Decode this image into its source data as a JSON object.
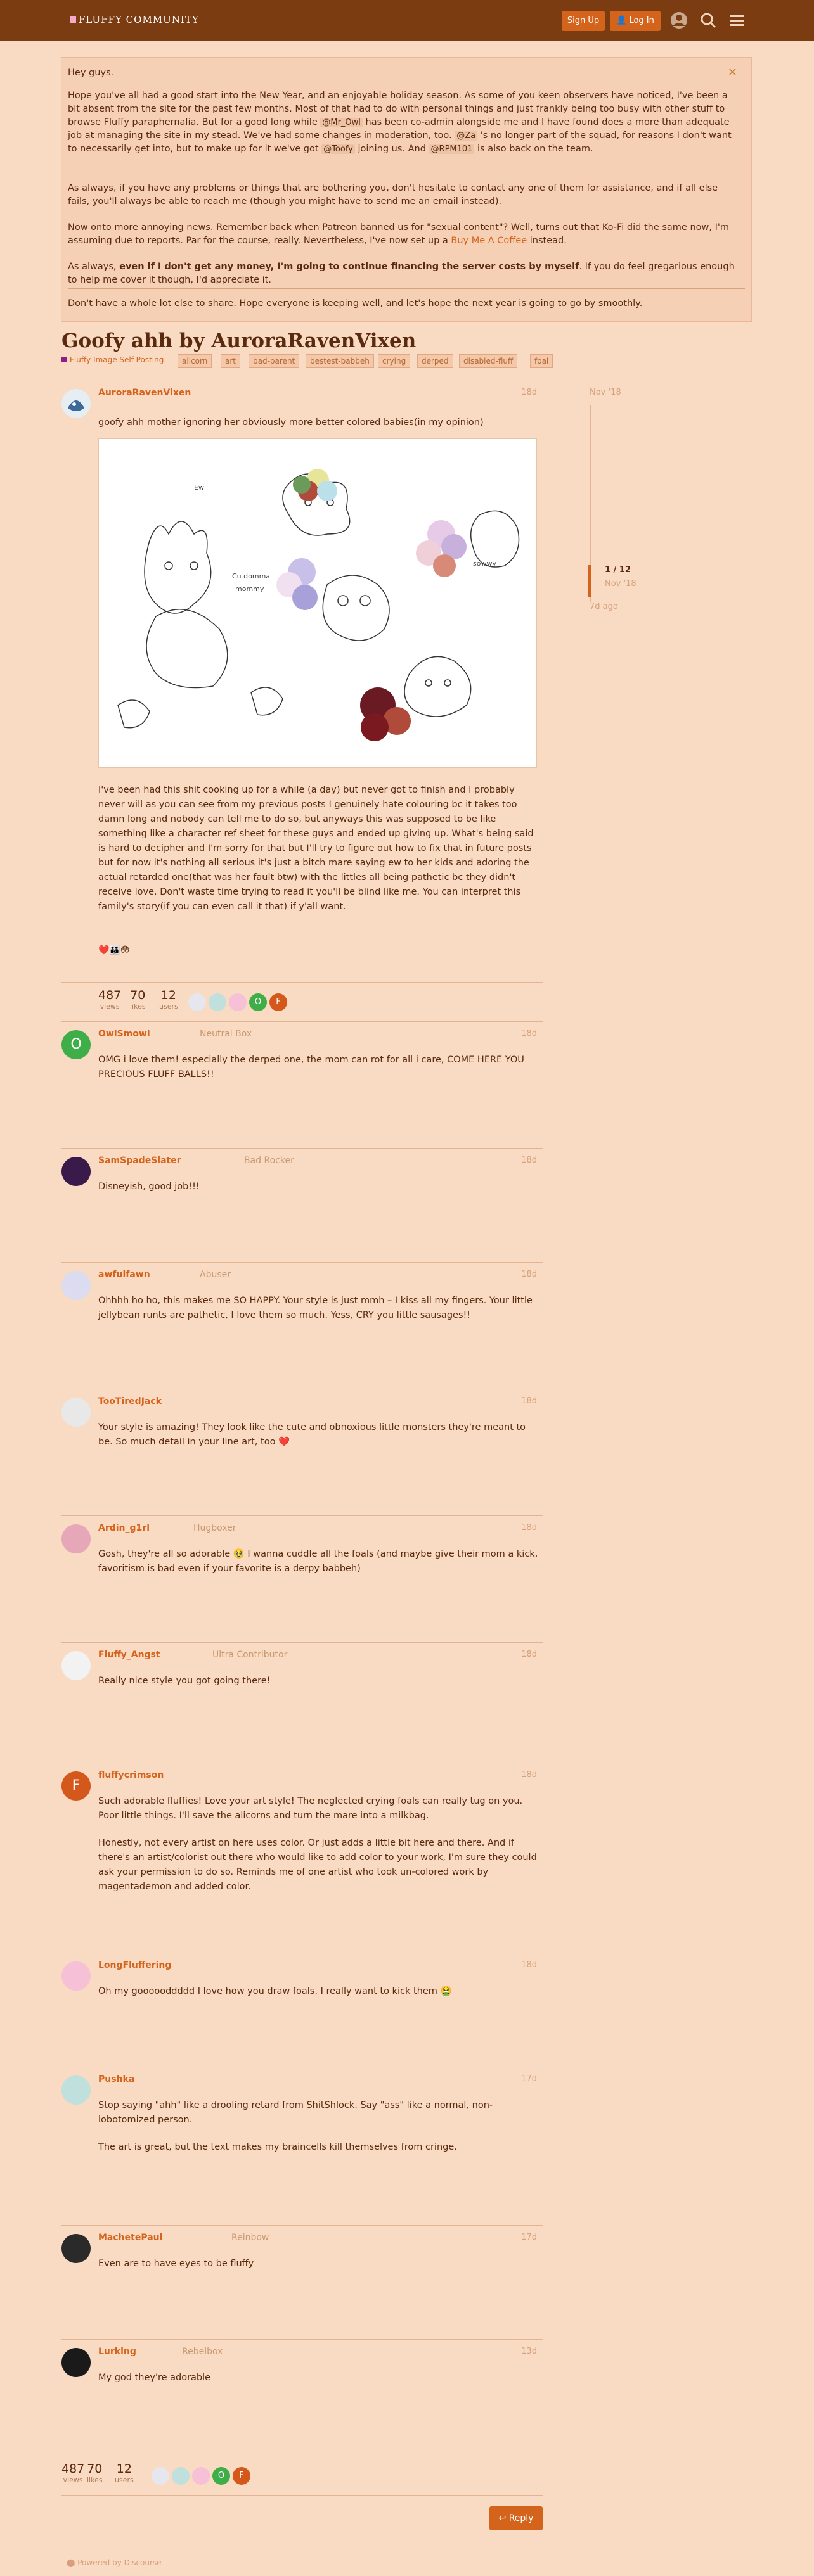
{
  "header": {
    "logo_text": "FLUFFY COMMUNITY",
    "signup_label": "Sign Up",
    "login_label": "Log In",
    "icons": [
      "account-icon",
      "search-icon",
      "menu-icon"
    ]
  },
  "banner": {
    "greeting": "Hey guys.",
    "p1": "Hope you've all had a good start into the New Year, and an enjoyable holiday season. As some of you keen observers have noticed, I've been a bit absent from the site for the past few months. Most of that had to do with personal things and just frankly being too busy with other stuff to browse Fluffy paraphernalia. But for a good long while @Mr_Owl has been co-admin alongside me and I have found does a more than adequate job at managing the site in my stead. We've had some changes in moderation, too. @Za 's no longer part of the squad, for reasons I don't want to necessarily get into, but to make up for it we've got @Toofy joining us. And @RPM101 is also back on the team.",
    "p1a": "Hope you've all had a good start into the New Year, and an enjoyable holiday season. As some of you keen observers have noticed, I've been a bit absent from the site for the past few months. Most of that had to do with personal things and just frankly being too busy with other stuff to browse Fluffy paraphernalia. But for a good long while ",
    "m1": "@Mr_Owl",
    "p1b": " has been co-admin alongside me and I have found does a more than adequate job at managing the site in my stead. We've had some changes in moderation, too. ",
    "m2": "@Za",
    "p1c": " 's no longer part of the squad, for reasons I don't want to necessarily get into, but to make up for it we've got ",
    "m3": "@Toofy",
    "p1d": " joining us. And ",
    "m4": "@RPM101",
    "p1e": " is also back on the team.",
    "p2": "As always, if you have any problems or things that are bothering you, don't hesitate to contact any one of them for assistance, and if all else fails, you'll always be able to reach me (though you might have to send me an email instead).",
    "p3a": "Now onto more annoying news. Remember back when Patreon banned us for \"sexual content\"? Well, turns out that Ko-Fi did the same now, I'm assuming due to reports. Par for the course, really. Nevertheless, I've now set up a ",
    "p3link": "Buy Me A Coffee",
    "p3b": " instead.",
    "p4a": "As always, ",
    "p4bold": "even if I don't get any money, I'm going to continue financing the server costs by myself",
    "p4b": ". If you do feel gregarious enough to help me cover it though, I'd appreciate it.",
    "p5": "Don't have a whole lot else to share. Hope everyone is keeping well, and let's hope the next year is going to go by smoothly.",
    "close_label": "×"
  },
  "topic": {
    "title": "Goofy ahh by AuroraRavenVixen",
    "category": "Fluffy Image Self-Posting",
    "tags": [
      "alicorn",
      "art",
      "bad-parent",
      "bestest-babbeh",
      "crying",
      "derped",
      "disabled-fluff",
      "foal"
    ]
  },
  "timeline": {
    "start": "Nov '18",
    "position": "1 / 12",
    "position_date": "Nov '18",
    "end": "7d ago"
  },
  "op": {
    "username": "AuroraRavenVixen",
    "date": "18d",
    "intro": "goofy ahh mother ignoring her obviously more better colored babies(in my opinion)",
    "body": "I've been had this shit cooking up for a while (a day) but never got to finish and I probably never will as you can see from my previous posts I genuinely hate colouring bc it takes too damn long and nobody can tell me to do so, but anyways this was supposed to be like something like a character ref sheet for these guys and ended up giving up. What's being said is hard to decipher and I'm sorry for that but I'll try to figure out how to fix that in future posts but for now it's nothing all serious it's just a bitch mare saying ew to her kids and adoring the actual retarded one(that was her fault btw) with the littles all being pathetic bc they didn't receive love. Don't waste time trying to read it you'll be blind like me. You can interpret this family's story(if you can even call it that) if y'all want.",
    "reactions": "❤️👪😳"
  },
  "stats": {
    "views": "487",
    "views_label": "views",
    "likes": "70",
    "likes_label": "likes",
    "users": "12",
    "users_label": "users"
  },
  "replies": [
    {
      "username": "OwlSmowl",
      "title": "Neutral Box",
      "date": "18d",
      "avatar_letter": "O",
      "avatar_color": "#3fae49",
      "paragraphs": [
        "OMG i love them! especially the derped one, the mom can rot for all i care, COME HERE YOU PRECIOUS FLUFF BALLS!!"
      ]
    },
    {
      "username": "SamSpadeSlater",
      "title": "Bad Rocker",
      "date": "18d",
      "avatar_letter": "",
      "avatar_color": "#3a1a4a",
      "paragraphs": [
        "Disneyish, good job!!!"
      ]
    },
    {
      "username": "awfulfawn",
      "title": "Abuser",
      "date": "18d",
      "avatar_letter": "",
      "avatar_color": "#dcdcf0",
      "paragraphs": [
        "Ohhhh ho ho, this makes me SO HAPPY. Your style is just mmh – I kiss all my fingers. Your little jellybean runts are pathetic, I love them so much. Yess, CRY you little sausages!!"
      ]
    },
    {
      "username": "TooTiredJack",
      "title": "",
      "date": "18d",
      "avatar_letter": "",
      "avatar_color": "#e8e8e8",
      "paragraphs": [
        "Your style is amazing! They look like the cute and obnoxious little monsters they're meant to be. So much detail in your line art, too ❤️"
      ]
    },
    {
      "username": "Ardin_g1rl",
      "title": "Hugboxer",
      "date": "18d",
      "avatar_letter": "",
      "avatar_color": "#e6a8b8",
      "paragraphs": [
        "Gosh, they're all so adorable 🥹 I wanna cuddle all the foals (and maybe give their mom a kick, favoritism is bad even if your favorite is a derpy babbeh)"
      ]
    },
    {
      "username": "Fluffy_Angst",
      "title": "Ultra Contributor",
      "date": "18d",
      "avatar_letter": "",
      "avatar_color": "#f2f2f2",
      "paragraphs": [
        "Really nice style you got going there!"
      ]
    },
    {
      "username": "fluffycrimson",
      "title": "",
      "date": "18d",
      "avatar_letter": "F",
      "avatar_color": "#d4581c",
      "paragraphs": [
        "Such adorable fluffies! Love your art style! The neglected crying foals can really tug on you. Poor little things. I'll save the alicorns and turn the mare into a milkbag.",
        "Honestly, not every artist on here uses color. Or just adds a little bit here and there. And if there's an artist/colorist out there who would like to add color to your work, I'm sure they could ask your permission to do so. Reminds me of one artist who took un-colored work by magentademon and added color."
      ]
    },
    {
      "username": "LongFluffering",
      "title": "",
      "date": "18d",
      "avatar_letter": "",
      "avatar_color": "#f6c0d6",
      "paragraphs": [
        "Oh my goooooddddd I love how you draw foals. I really want to kick them 🤮"
      ]
    },
    {
      "username": "Pushka",
      "title": "",
      "date": "17d",
      "avatar_letter": "",
      "avatar_color": "#bfe0dc",
      "paragraphs": [
        "Stop saying \"ahh\" like a drooling retard from ShitShlock. Say \"ass\" like a normal, non-lobotomized person.",
        "The art is great, but the text makes my braincells kill themselves from cringe."
      ]
    },
    {
      "username": "MachetePaul",
      "title": "Reinbow",
      "date": "17d",
      "avatar_letter": "",
      "avatar_color": "#2a2a2a",
      "paragraphs": [
        "Even are to have eyes to be fluffy"
      ]
    },
    {
      "username": "Lurking",
      "title": "Rebelbox",
      "date": "13d",
      "avatar_letter": "",
      "avatar_color": "#1a1a1a",
      "paragraphs": [
        "My god they're adorable"
      ]
    }
  ],
  "footer": {
    "reply_label": "Reply",
    "powered": "Powered by Discourse"
  },
  "colors": {
    "header": "#7a3c10",
    "accent": "#d4631c",
    "background": "#f9dac3"
  }
}
